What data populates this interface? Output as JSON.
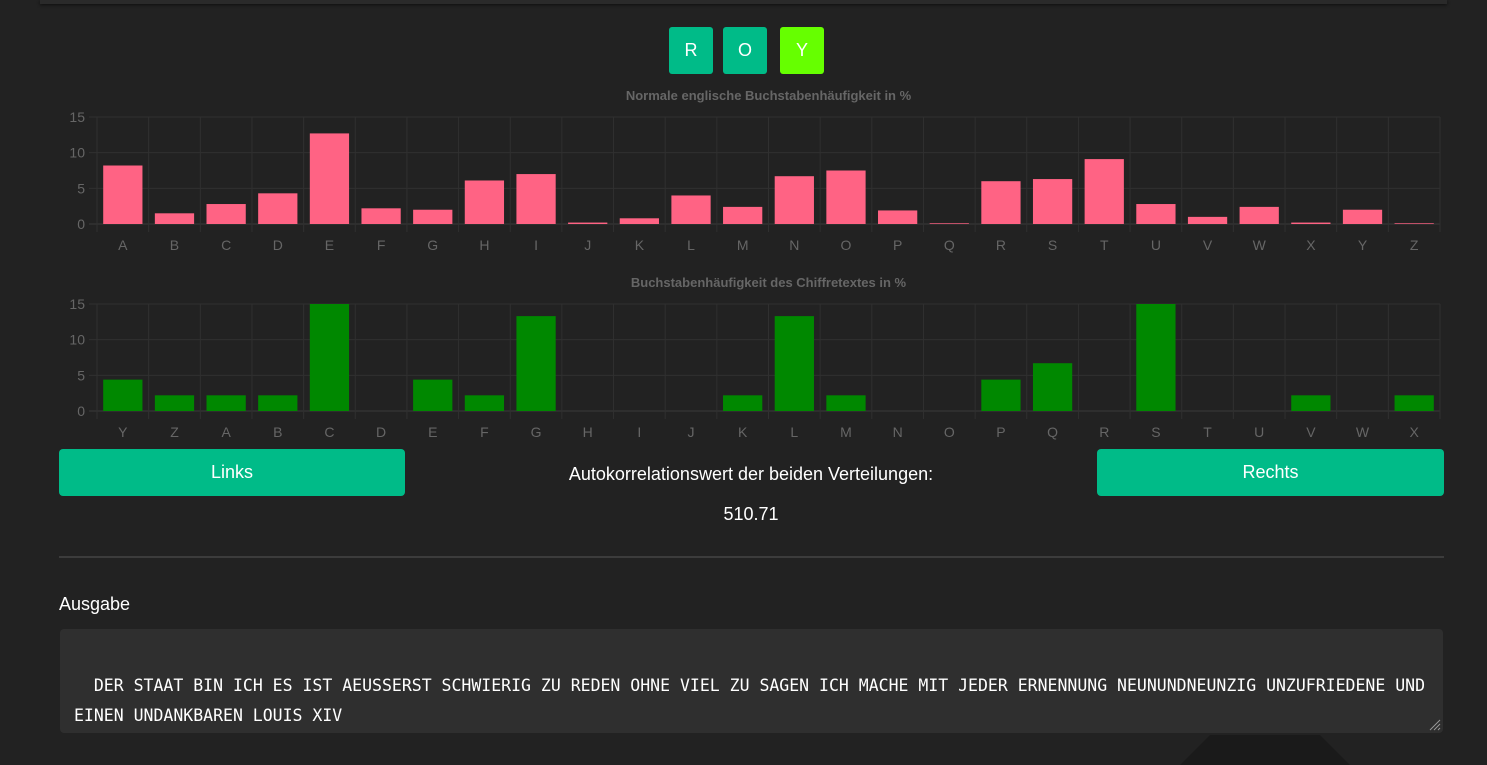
{
  "key": {
    "letters": [
      "R",
      "O",
      "Y"
    ],
    "colors": [
      "#00bb88",
      "#00bb88",
      "#66ff00"
    ]
  },
  "controls": {
    "left_label": "Links",
    "right_label": "Rechts",
    "button_color": "#00bb88"
  },
  "correlation": {
    "label": "Autokorrelationswert der beiden Verteilungen:",
    "value": "510.71"
  },
  "output": {
    "label": "Ausgabe",
    "text": "DER STAAT BIN ICH ES IST AEUSSERST SCHWIERIG ZU REDEN OHNE VIEL ZU SAGEN ICH MACHE MIT JEDER ERNENNUNG NEUNUNDNEUNZIG UNZUFRIEDENE UND EINEN UNDANKBAREN LOUIS XIV"
  },
  "chart_data": [
    {
      "type": "bar",
      "title": "Normale englische Buchstabenhäufigkeit in %",
      "color": "#ff6384",
      "ylim": [
        0,
        15
      ],
      "yticks": [
        0,
        5,
        10,
        15
      ],
      "grid": true,
      "categories": [
        "A",
        "B",
        "C",
        "D",
        "E",
        "F",
        "G",
        "H",
        "I",
        "J",
        "K",
        "L",
        "M",
        "N",
        "O",
        "P",
        "Q",
        "R",
        "S",
        "T",
        "U",
        "V",
        "W",
        "X",
        "Y",
        "Z"
      ],
      "values": [
        8.2,
        1.5,
        2.8,
        4.3,
        12.7,
        2.2,
        2.0,
        6.1,
        7.0,
        0.2,
        0.8,
        4.0,
        2.4,
        6.7,
        7.5,
        1.9,
        0.1,
        6.0,
        6.3,
        9.1,
        2.8,
        1.0,
        2.4,
        0.2,
        2.0,
        0.1
      ]
    },
    {
      "type": "bar",
      "title": "Buchstabenhäufigkeit des Chiffretextes in %",
      "color": "#008800",
      "ylim": [
        0,
        15
      ],
      "yticks": [
        0,
        5,
        10,
        15
      ],
      "grid": true,
      "categories": [
        "Y",
        "Z",
        "A",
        "B",
        "C",
        "D",
        "E",
        "F",
        "G",
        "H",
        "I",
        "J",
        "K",
        "L",
        "M",
        "N",
        "O",
        "P",
        "Q",
        "R",
        "S",
        "T",
        "U",
        "V",
        "W",
        "X"
      ],
      "values": [
        4.4,
        2.2,
        2.2,
        2.2,
        15.0,
        0,
        4.4,
        2.2,
        13.3,
        0,
        0,
        0,
        2.2,
        13.3,
        2.2,
        0,
        0,
        4.4,
        6.7,
        0,
        15.0,
        0,
        0,
        2.2,
        0,
        2.2
      ]
    }
  ]
}
